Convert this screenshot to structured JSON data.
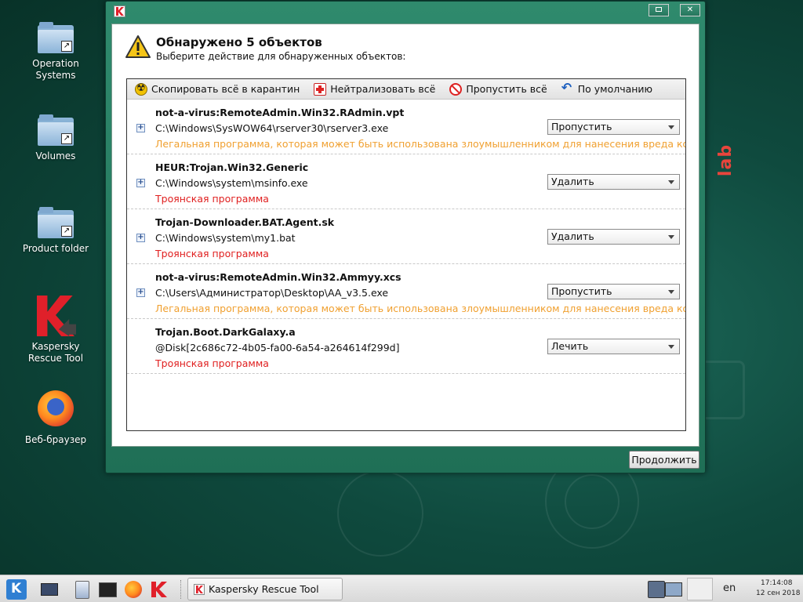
{
  "desktop": {
    "icons": [
      {
        "label": "Operation\nSystems",
        "icon": "folder-link-icon"
      },
      {
        "label": "Volumes",
        "icon": "folder-link-icon"
      },
      {
        "label": "Product folder",
        "icon": "folder-link-icon"
      },
      {
        "label": "Kaspersky\nRescue Tool",
        "icon": "kaspersky-icon"
      },
      {
        "label": "Веб-браузер",
        "icon": "firefox-icon"
      }
    ]
  },
  "window": {
    "title_icon": "kaspersky-icon",
    "heading": "Обнаружено 5 объектов",
    "subheading": "Выберите действие для обнаруженных объектов:",
    "toolbar": {
      "quarantine_all": "Скопировать всё в карантин",
      "disinfect_all": "Нейтрализовать всё",
      "skip_all": "Пропустить всё",
      "default": "По умолчанию"
    },
    "threats": [
      {
        "name": "not-a-virus:RemoteAdmin.Win32.RAdmin.vpt",
        "path": "C:\\Windows\\SysWOW64\\rserver30\\rserver3.exe",
        "description": "Легальная программа, которая может быть использована злоумышленником для нанесения вреда ком...",
        "type": "legal",
        "action": "Пропустить"
      },
      {
        "name": "HEUR:Trojan.Win32.Generic",
        "path": "C:\\Windows\\system\\msinfo.exe",
        "description": "Троянская программа",
        "type": "trojan",
        "action": "Удалить"
      },
      {
        "name": "Trojan-Downloader.BAT.Agent.sk",
        "path": "C:\\Windows\\system\\my1.bat",
        "description": "Троянская программа",
        "type": "trojan",
        "action": "Удалить"
      },
      {
        "name": "not-a-virus:RemoteAdmin.Win32.Ammyy.xcs",
        "path": "C:\\Users\\Администратор\\Desktop\\AA_v3.5.exe",
        "description": "Легальная программа, которая может быть использована злоумышленником для нанесения вреда ком...",
        "type": "legal",
        "action": "Пропустить"
      },
      {
        "name": "Trojan.Boot.DarkGalaxy.a",
        "path": "@Disk[2c686c72-4b05-fa00-6a54-a264614f299d]",
        "description": "Троянская программа",
        "type": "trojan",
        "action": "Лечить"
      }
    ],
    "continue_label": "Продолжить"
  },
  "taskbar": {
    "task_label": "Kaspersky Rescue Tool",
    "language": "en",
    "time": "17:14:08",
    "date": "12 сен 2018"
  },
  "colors": {
    "legal_description": "#f0a030",
    "trojan_description": "#e02020",
    "window_frame": "#2f8a6d"
  }
}
